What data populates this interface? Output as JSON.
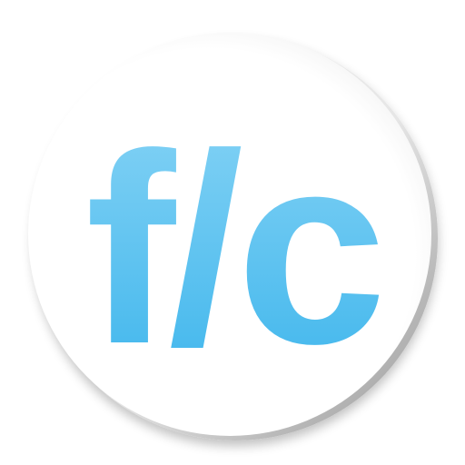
{
  "app_icon": {
    "glyph": "f/c",
    "name": "fc-app-icon",
    "colors": {
      "glyph_top": "#86D3F5",
      "glyph_bottom": "#3DB5EC",
      "circle_face": "#FFFFFF",
      "rim_shadow": "#BDBDBD"
    }
  }
}
